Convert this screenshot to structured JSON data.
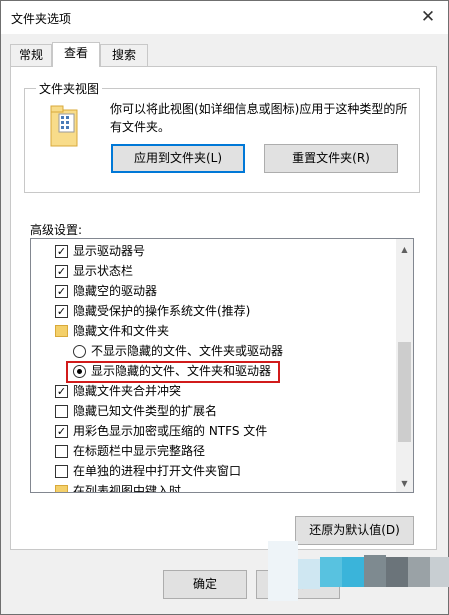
{
  "window": {
    "title": "文件夹选项",
    "close_glyph": "✕"
  },
  "tabs": [
    {
      "label": "常规",
      "active": false
    },
    {
      "label": "查看",
      "active": true
    },
    {
      "label": "搜索",
      "active": false
    }
  ],
  "folder_views": {
    "group_title": "文件夹视图",
    "description": "你可以将此视图(如详细信息或图标)应用于这种类型的所有文件夹。",
    "apply_button": "应用到文件夹(L)",
    "reset_button": "重置文件夹(R)"
  },
  "advanced": {
    "label": "高级设置:",
    "items": [
      {
        "type": "checkbox",
        "checked": true,
        "label": "显示驱动器号"
      },
      {
        "type": "checkbox",
        "checked": true,
        "label": "显示状态栏"
      },
      {
        "type": "checkbox",
        "checked": true,
        "label": "隐藏空的驱动器"
      },
      {
        "type": "checkbox",
        "checked": true,
        "label": "隐藏受保护的操作系统文件(推荐)"
      },
      {
        "type": "folder",
        "label": "隐藏文件和文件夹"
      },
      {
        "type": "radio",
        "selected": false,
        "label": "不显示隐藏的文件、文件夹或驱动器"
      },
      {
        "type": "radio",
        "selected": true,
        "label": "显示隐藏的文件、文件夹和驱动器"
      },
      {
        "type": "checkbox",
        "checked": true,
        "label": "隐藏文件夹合并冲突"
      },
      {
        "type": "checkbox",
        "checked": false,
        "label": "隐藏已知文件类型的扩展名"
      },
      {
        "type": "checkbox",
        "checked": true,
        "label": "用彩色显示加密或压缩的 NTFS 文件"
      },
      {
        "type": "checkbox",
        "checked": false,
        "label": "在标题栏中显示完整路径"
      },
      {
        "type": "checkbox",
        "checked": false,
        "label": "在单独的进程中打开文件夹窗口"
      },
      {
        "type": "folder",
        "label": "在列表视图中键入时"
      }
    ]
  },
  "buttons": {
    "restore_defaults": "还原为默认值(D)",
    "ok": "确定",
    "cancel": "取"
  },
  "colors": {
    "highlight_border": "#d11b1b",
    "focus_border": "#0078d7"
  }
}
